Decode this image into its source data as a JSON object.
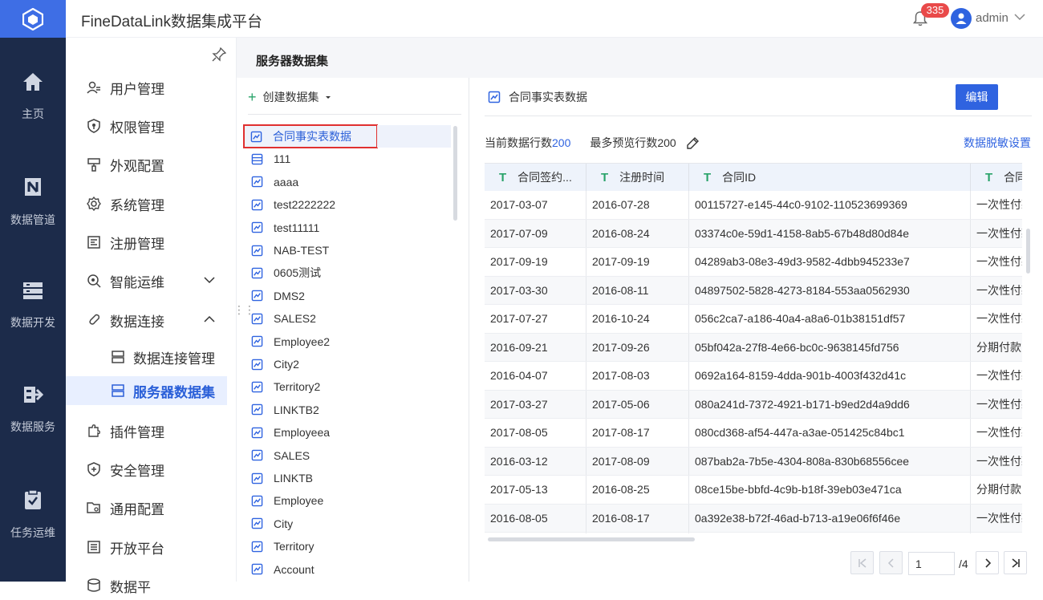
{
  "app": {
    "title": "FineDataLink数据集成平台"
  },
  "nav": {
    "items": [
      {
        "label": "主页",
        "icon": "home-icon"
      },
      {
        "label": "数据管道",
        "icon": "pipeline-icon"
      },
      {
        "label": "数据开发",
        "icon": "dev-icon"
      },
      {
        "label": "数据服务",
        "icon": "service-icon"
      },
      {
        "label": "任务运维",
        "icon": "task-icon"
      }
    ]
  },
  "header": {
    "notification_count": "335",
    "user": "admin"
  },
  "sidebar": {
    "items": [
      {
        "label": "用户管理",
        "icon": "user-icon"
      },
      {
        "label": "权限管理",
        "icon": "shield-icon"
      },
      {
        "label": "外观配置",
        "icon": "brush-icon"
      },
      {
        "label": "系统管理",
        "icon": "gear-icon"
      },
      {
        "label": "注册管理",
        "icon": "register-icon"
      },
      {
        "label": "智能运维",
        "icon": "ops-icon",
        "expandable": "collapsed"
      },
      {
        "label": "数据连接",
        "icon": "link-icon",
        "expandable": "expanded"
      },
      {
        "label": "插件管理",
        "icon": "plugin-icon"
      },
      {
        "label": "安全管理",
        "icon": "security-icon"
      },
      {
        "label": "通用配置",
        "icon": "folder-gear-icon"
      },
      {
        "label": "开放平台",
        "icon": "list-icon"
      },
      {
        "label": "数据平",
        "icon": "data-icon"
      }
    ],
    "sub_items": [
      {
        "label": "数据连接管理",
        "active": false
      },
      {
        "label": "服务器数据集",
        "active": true
      }
    ]
  },
  "section_title": "服务器数据集",
  "list": {
    "create_label": "创建数据集",
    "datasets": [
      "合同事实表数据",
      "111",
      "aaaa",
      "test2222222",
      "test11111",
      "NAB-TEST",
      "0605测试",
      "DMS2",
      "SALES2",
      "Employee2",
      "City2",
      "Territory2",
      "LINKTB2",
      "Employeea",
      "SALES",
      "LINKTB",
      "Employee",
      "City",
      "Territory",
      "Account"
    ],
    "selected": "合同事实表数据"
  },
  "preview": {
    "title": "合同事实表数据",
    "edit_label": "编辑",
    "row_count_label": "当前数据行数",
    "row_count": "200",
    "max_preview_label": "最多预览行数",
    "max_preview": "200",
    "mask_link": "数据脱敏设置",
    "columns": [
      "合同签约...",
      "注册时间",
      "合同ID",
      "合同"
    ],
    "rows": [
      [
        "2017-03-07",
        "2016-07-28",
        "00115727-e145-44c0-9102-110523699369",
        "一次性付款"
      ],
      [
        "2017-07-09",
        "2016-08-24",
        "03374c0e-59d1-4158-8ab5-67b48d80d84e",
        "一次性付款"
      ],
      [
        "2017-09-19",
        "2017-09-19",
        "04289ab3-08e3-49d3-9582-4dbb945233e7",
        "一次性付款"
      ],
      [
        "2017-03-30",
        "2016-08-11",
        "04897502-5828-4273-8184-553aa0562930",
        "一次性付款"
      ],
      [
        "2017-07-27",
        "2016-10-24",
        "056c2ca7-a186-40a4-a8a6-01b38151df57",
        "一次性付款"
      ],
      [
        "2016-09-21",
        "2017-09-26",
        "05bf042a-27f8-4e66-bc0c-9638145fd756",
        "分期付款"
      ],
      [
        "2016-04-07",
        "2017-08-03",
        "0692a164-8159-4dda-901b-4003f432d41c",
        "一次性付款"
      ],
      [
        "2017-03-27",
        "2017-05-06",
        "080a241d-7372-4921-b171-b9ed2d4a9dd6",
        "一次性付款"
      ],
      [
        "2017-08-05",
        "2017-08-17",
        "080cd368-af54-447a-a3ae-051425c84bc1",
        "一次性付款"
      ],
      [
        "2016-03-12",
        "2017-08-09",
        "087bab2a-7b5e-4304-808a-830b68556cee",
        "一次性付款"
      ],
      [
        "2017-05-13",
        "2016-08-25",
        "08ce15be-bbfd-4c9b-b18f-39eb03e471ca",
        "分期付款"
      ],
      [
        "2016-08-05",
        "2016-08-17",
        "0a392e38-b72f-46ad-b713-a19e06f6f46e",
        "一次性付款"
      ],
      [
        "",
        "",
        "",
        ""
      ]
    ]
  },
  "pagination": {
    "current": "1",
    "total": "/4"
  }
}
